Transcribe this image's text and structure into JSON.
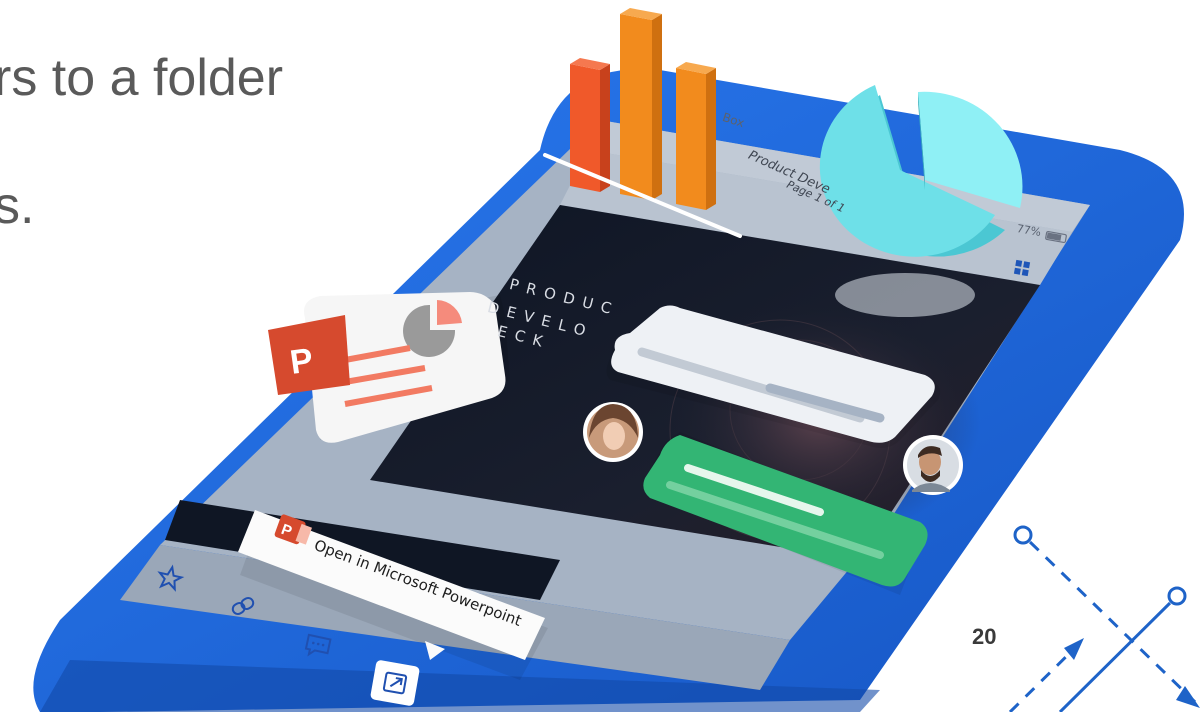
{
  "slide": {
    "heading_line1": "rs to a folder",
    "heading_line2": "s.",
    "page_number": "20"
  },
  "phone": {
    "status": {
      "carrier": "Box",
      "battery": "77%"
    },
    "document": {
      "title": "Product Deve",
      "pages": "Page 1 of 1"
    },
    "deck": {
      "line1": "PRODUC",
      "line2": "DEVELO",
      "line3": "ECK"
    },
    "toast": {
      "label": "Open in Microsoft Powerpoint"
    },
    "toolbar": [
      "star-icon",
      "link-icon",
      "comment-icon",
      "open-in-icon"
    ]
  },
  "colors": {
    "phone_body": "#1a66d9",
    "screen_bg": "#a6b3c4",
    "bar_orange": "#f28b1d",
    "bar_red": "#f0592a",
    "pie": "#6ee0e8",
    "chat_green": "#33b574",
    "ppt_red": "#d64a2e",
    "accent_blue": "#1e63c8"
  }
}
